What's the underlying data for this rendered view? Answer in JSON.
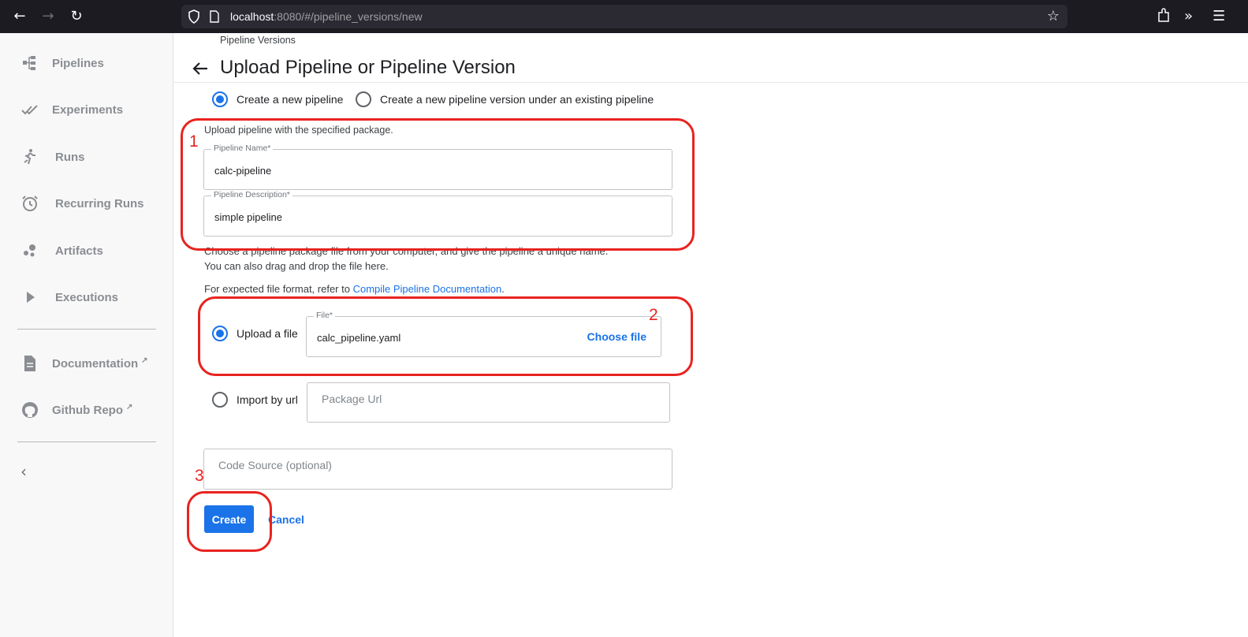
{
  "browser": {
    "url_host": "localhost",
    "url_rest": ":8080/#/pipeline_versions/new"
  },
  "sidebar": {
    "items": [
      {
        "label": "Pipelines",
        "icon": "pipelines-icon"
      },
      {
        "label": "Experiments",
        "icon": "experiments-icon"
      },
      {
        "label": "Runs",
        "icon": "runs-icon"
      },
      {
        "label": "Recurring Runs",
        "icon": "alarm-clock-icon"
      },
      {
        "label": "Artifacts",
        "icon": "artifacts-icon"
      },
      {
        "label": "Executions",
        "icon": "play-icon"
      },
      {
        "label": "Documentation",
        "icon": "document-icon"
      },
      {
        "label": "Github Repo",
        "icon": "github-icon"
      }
    ]
  },
  "header": {
    "breadcrumb": "Pipeline Versions",
    "title": "Upload Pipeline or Pipeline Version"
  },
  "form": {
    "mode_options": [
      {
        "label": "Create a new pipeline",
        "selected": true
      },
      {
        "label": "Create a new pipeline version under an existing pipeline",
        "selected": false
      }
    ],
    "upload_hint": "Upload pipeline with the specified package.",
    "pipeline_name": {
      "label": "Pipeline Name*",
      "value": "calc-pipeline"
    },
    "pipeline_description": {
      "label": "Pipeline Description*",
      "value": "simple pipeline"
    },
    "choose_text_line1": "Choose a pipeline package file from your computer, and give the pipeline a unique name.",
    "choose_text_line2": "You can also drag and drop the file here.",
    "format_prefix": "For expected file format, refer to ",
    "format_link": "Compile Pipeline Documentation",
    "format_suffix": ".",
    "upload_option": {
      "label": "Upload a file",
      "selected": true
    },
    "file": {
      "label": "File*",
      "value": "calc_pipeline.yaml",
      "choose_label": "Choose file"
    },
    "url_option": {
      "label": "Import by url",
      "selected": false
    },
    "package_url_placeholder": "Package Url",
    "code_source_placeholder": "Code Source (optional)",
    "create_label": "Create",
    "cancel_label": "Cancel"
  },
  "annotations": [
    "1",
    "2",
    "3"
  ],
  "colors": {
    "accent": "#1a73e8",
    "annotation": "#e8231f",
    "sidebar_bg": "#f8f8f9",
    "browser_bg": "#1c1b22"
  }
}
